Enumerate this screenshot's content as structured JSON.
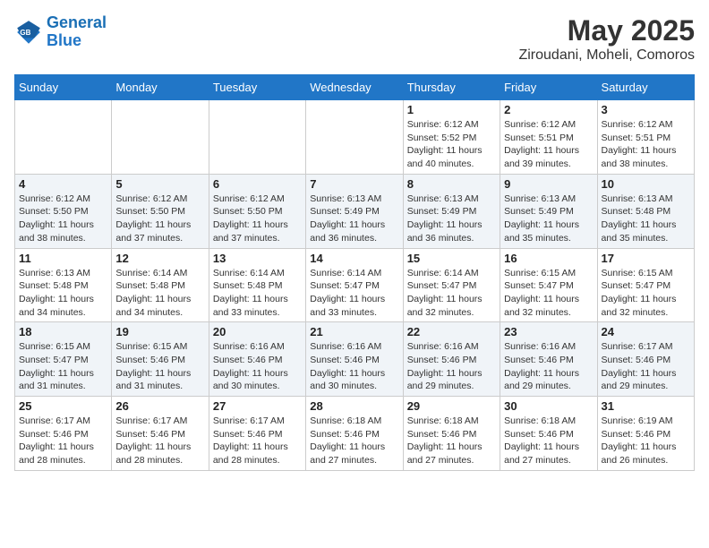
{
  "logo": {
    "line1": "General",
    "line2": "Blue"
  },
  "title": "May 2025",
  "subtitle": "Ziroudani, Moheli, Comoros",
  "days_of_week": [
    "Sunday",
    "Monday",
    "Tuesday",
    "Wednesday",
    "Thursday",
    "Friday",
    "Saturday"
  ],
  "weeks": [
    [
      {
        "day": "",
        "info": ""
      },
      {
        "day": "",
        "info": ""
      },
      {
        "day": "",
        "info": ""
      },
      {
        "day": "",
        "info": ""
      },
      {
        "day": "1",
        "info": "Sunrise: 6:12 AM\nSunset: 5:52 PM\nDaylight: 11 hours\nand 40 minutes."
      },
      {
        "day": "2",
        "info": "Sunrise: 6:12 AM\nSunset: 5:51 PM\nDaylight: 11 hours\nand 39 minutes."
      },
      {
        "day": "3",
        "info": "Sunrise: 6:12 AM\nSunset: 5:51 PM\nDaylight: 11 hours\nand 38 minutes."
      }
    ],
    [
      {
        "day": "4",
        "info": "Sunrise: 6:12 AM\nSunset: 5:50 PM\nDaylight: 11 hours\nand 38 minutes."
      },
      {
        "day": "5",
        "info": "Sunrise: 6:12 AM\nSunset: 5:50 PM\nDaylight: 11 hours\nand 37 minutes."
      },
      {
        "day": "6",
        "info": "Sunrise: 6:12 AM\nSunset: 5:50 PM\nDaylight: 11 hours\nand 37 minutes."
      },
      {
        "day": "7",
        "info": "Sunrise: 6:13 AM\nSunset: 5:49 PM\nDaylight: 11 hours\nand 36 minutes."
      },
      {
        "day": "8",
        "info": "Sunrise: 6:13 AM\nSunset: 5:49 PM\nDaylight: 11 hours\nand 36 minutes."
      },
      {
        "day": "9",
        "info": "Sunrise: 6:13 AM\nSunset: 5:49 PM\nDaylight: 11 hours\nand 35 minutes."
      },
      {
        "day": "10",
        "info": "Sunrise: 6:13 AM\nSunset: 5:48 PM\nDaylight: 11 hours\nand 35 minutes."
      }
    ],
    [
      {
        "day": "11",
        "info": "Sunrise: 6:13 AM\nSunset: 5:48 PM\nDaylight: 11 hours\nand 34 minutes."
      },
      {
        "day": "12",
        "info": "Sunrise: 6:14 AM\nSunset: 5:48 PM\nDaylight: 11 hours\nand 34 minutes."
      },
      {
        "day": "13",
        "info": "Sunrise: 6:14 AM\nSunset: 5:48 PM\nDaylight: 11 hours\nand 33 minutes."
      },
      {
        "day": "14",
        "info": "Sunrise: 6:14 AM\nSunset: 5:47 PM\nDaylight: 11 hours\nand 33 minutes."
      },
      {
        "day": "15",
        "info": "Sunrise: 6:14 AM\nSunset: 5:47 PM\nDaylight: 11 hours\nand 32 minutes."
      },
      {
        "day": "16",
        "info": "Sunrise: 6:15 AM\nSunset: 5:47 PM\nDaylight: 11 hours\nand 32 minutes."
      },
      {
        "day": "17",
        "info": "Sunrise: 6:15 AM\nSunset: 5:47 PM\nDaylight: 11 hours\nand 32 minutes."
      }
    ],
    [
      {
        "day": "18",
        "info": "Sunrise: 6:15 AM\nSunset: 5:47 PM\nDaylight: 11 hours\nand 31 minutes."
      },
      {
        "day": "19",
        "info": "Sunrise: 6:15 AM\nSunset: 5:46 PM\nDaylight: 11 hours\nand 31 minutes."
      },
      {
        "day": "20",
        "info": "Sunrise: 6:16 AM\nSunset: 5:46 PM\nDaylight: 11 hours\nand 30 minutes."
      },
      {
        "day": "21",
        "info": "Sunrise: 6:16 AM\nSunset: 5:46 PM\nDaylight: 11 hours\nand 30 minutes."
      },
      {
        "day": "22",
        "info": "Sunrise: 6:16 AM\nSunset: 5:46 PM\nDaylight: 11 hours\nand 29 minutes."
      },
      {
        "day": "23",
        "info": "Sunrise: 6:16 AM\nSunset: 5:46 PM\nDaylight: 11 hours\nand 29 minutes."
      },
      {
        "day": "24",
        "info": "Sunrise: 6:17 AM\nSunset: 5:46 PM\nDaylight: 11 hours\nand 29 minutes."
      }
    ],
    [
      {
        "day": "25",
        "info": "Sunrise: 6:17 AM\nSunset: 5:46 PM\nDaylight: 11 hours\nand 28 minutes."
      },
      {
        "day": "26",
        "info": "Sunrise: 6:17 AM\nSunset: 5:46 PM\nDaylight: 11 hours\nand 28 minutes."
      },
      {
        "day": "27",
        "info": "Sunrise: 6:17 AM\nSunset: 5:46 PM\nDaylight: 11 hours\nand 28 minutes."
      },
      {
        "day": "28",
        "info": "Sunrise: 6:18 AM\nSunset: 5:46 PM\nDaylight: 11 hours\nand 27 minutes."
      },
      {
        "day": "29",
        "info": "Sunrise: 6:18 AM\nSunset: 5:46 PM\nDaylight: 11 hours\nand 27 minutes."
      },
      {
        "day": "30",
        "info": "Sunrise: 6:18 AM\nSunset: 5:46 PM\nDaylight: 11 hours\nand 27 minutes."
      },
      {
        "day": "31",
        "info": "Sunrise: 6:19 AM\nSunset: 5:46 PM\nDaylight: 11 hours\nand 26 minutes."
      }
    ]
  ]
}
